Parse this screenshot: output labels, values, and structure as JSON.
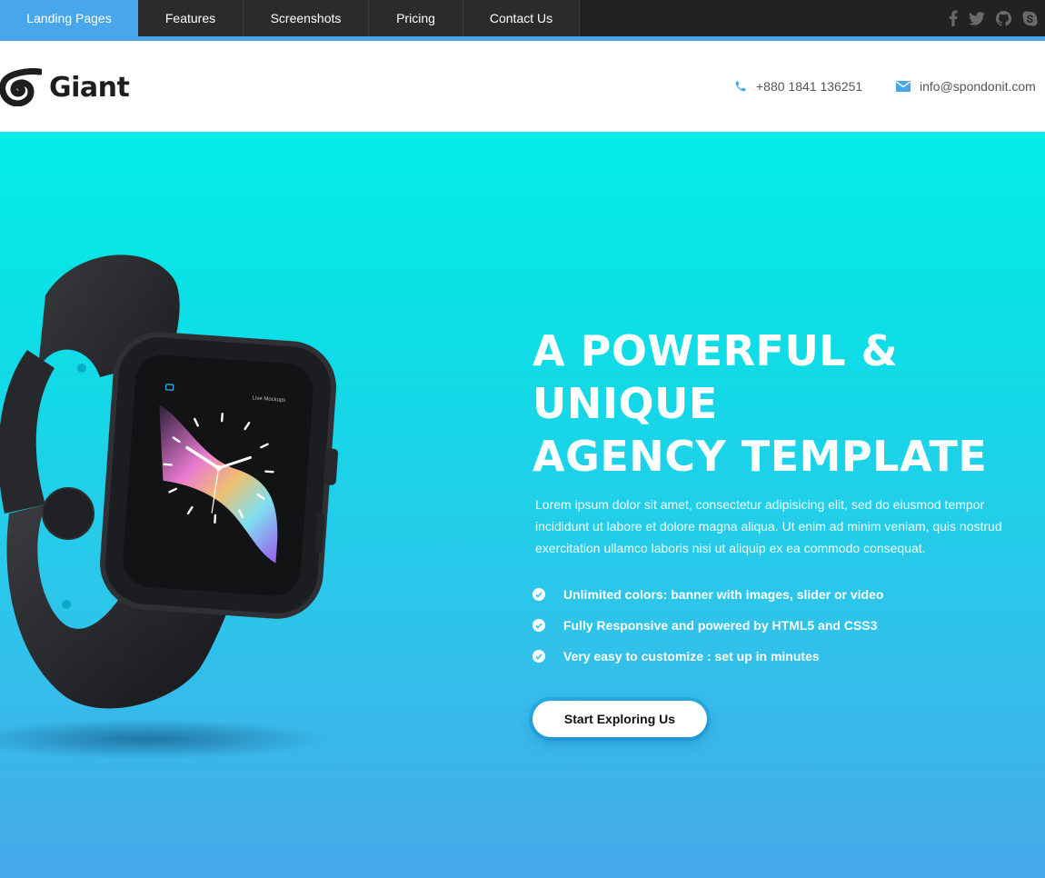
{
  "nav": {
    "items": [
      {
        "label": "Landing Pages"
      },
      {
        "label": "Features"
      },
      {
        "label": "Screenshots"
      },
      {
        "label": "Pricing"
      },
      {
        "label": "Contact Us"
      }
    ],
    "social": [
      "facebook-icon",
      "twitter-icon",
      "github-icon",
      "skype-icon"
    ]
  },
  "header": {
    "logo_text": "Giant",
    "phone": "+880 1841 136251",
    "email": "info@spondonit.com"
  },
  "hero": {
    "title_line1": "A POWERFUL & UNIQUE",
    "title_line2": "AGENCY TEMPLATE",
    "description": "Lorem ipsum dolor sit amet, consectetur adipisicing elit, sed do eiusmod tempor incididunt ut labore et dolore magna aliqua. Ut enim ad minim veniam, quis nostrud exercitation ullamco laboris nisi ut aliquip ex ea commodo consequat.",
    "features": [
      "Unlimited colors: banner with images, slider or video",
      "Fully Responsive and powered by HTML5 and CSS3",
      "Very easy to customize : set up in minutes"
    ],
    "cta_label": "Start Exploring Us",
    "watch_screen_label": "Live Mockups"
  },
  "colors": {
    "accent": "#48a6ea",
    "topbar": "#222222",
    "hero_top": "#03eee6",
    "hero_bottom": "#47a9ea"
  }
}
